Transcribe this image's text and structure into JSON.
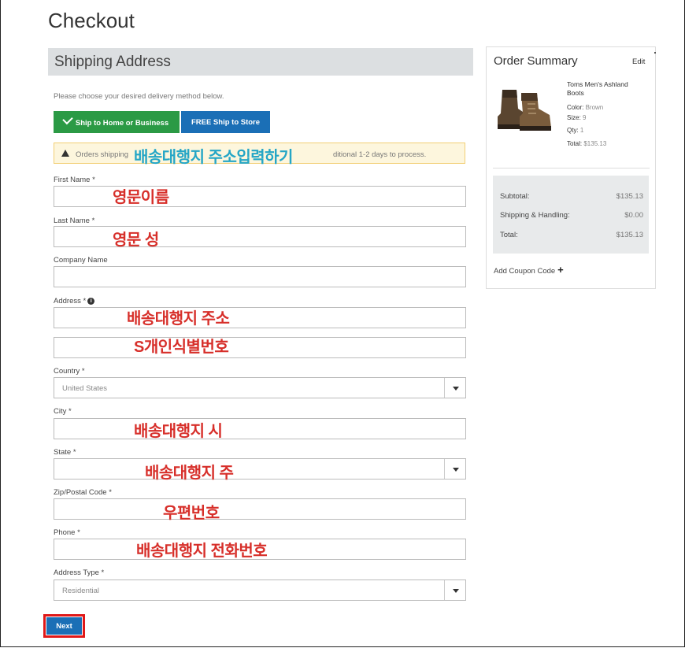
{
  "page": {
    "title": "Checkout"
  },
  "shipping": {
    "header": "Shipping Address",
    "helper_text": "Please choose your desired delivery method below.",
    "delivery_buttons": {
      "home": "Ship to Home or Business",
      "store": "FREE Ship to Store"
    },
    "notice_left": "Orders shipping",
    "notice_right": "ditional 1-2 days to process.",
    "fields": {
      "first_name": {
        "label": "First Name *",
        "value": ""
      },
      "last_name": {
        "label": "Last Name *",
        "value": ""
      },
      "company": {
        "label": "Company Name",
        "value": ""
      },
      "address": {
        "label": "Address *",
        "line1": "",
        "line2": ""
      },
      "country": {
        "label": "Country *",
        "value": "United States"
      },
      "city": {
        "label": "City *",
        "value": ""
      },
      "state": {
        "label": "State *",
        "value": ""
      },
      "zip": {
        "label": "Zip/Postal Code *",
        "value": ""
      },
      "phone": {
        "label": "Phone *",
        "value": ""
      },
      "address_type": {
        "label": "Address Type *",
        "value": "Residential"
      }
    },
    "next_label": "Next"
  },
  "annotations": {
    "notice": "배송대행지 주소입력하기",
    "first_name": "영문이름",
    "last_name": "영문 성",
    "address1": "배송대행지 주소",
    "address2": "S개인식별번호",
    "city": "배송대행지 시",
    "state": "배송대행지 주",
    "zip": "우편번호",
    "phone": "배송대행지 전화번호"
  },
  "summary": {
    "title": "Order Summary",
    "edit": "Edit",
    "product": {
      "name": "Toms Men's Ashland Boots",
      "color_label": "Color:",
      "color": "Brown",
      "size_label": "Size:",
      "size": "9",
      "qty_label": "Qty:",
      "qty": "1",
      "total_label": "Total:",
      "total": "$135.13"
    },
    "subtotal_label": "Subtotal:",
    "subtotal": "$135.13",
    "shipping_label": "Shipping & Handling:",
    "shipping": "$0.00",
    "total_label": "Total:",
    "total": "$135.13",
    "coupon": "Add Coupon Code"
  },
  "colors": {
    "green": "#2b9a45",
    "blue": "#1b6fb6",
    "annotation_red": "#d72f2a",
    "annotation_teal": "#25a6c6",
    "highlight": "#e01818"
  }
}
